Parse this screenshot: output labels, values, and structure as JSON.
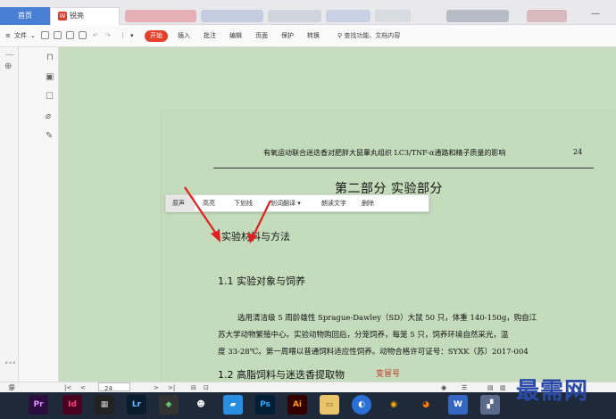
{
  "tabs": {
    "home": "首页",
    "doc": "锐亮"
  },
  "menu": {
    "file": "文件",
    "start": "开始",
    "insert": "插入",
    "comment": "批注",
    "edit": "编辑",
    "page": "页面",
    "protect": "保护",
    "convert": "转换",
    "search_placeholder": "查找功能、文档内容"
  },
  "document": {
    "header_text": "有氧运动联合迷迭香对肥胖大鼠睾丸组织 LC3/TNF-α通路和精子质量的影响",
    "header_page": "24",
    "part_title": "第二部分  实验部分",
    "section1": "实验材料与方法",
    "section1_1": "1.1 实验对象与饲养",
    "para_line1": "选用清洁级 5 周龄雄性 Sprague-Dawley（SD）大鼠 50 只，体重 140-150g，购自江",
    "para_line2": "苏大学动物繁殖中心。实验动物购回后，分笼饲养，每笼 5 只，饲养环境自然采光，温",
    "para_line3": "度 33-28℃。第一周喂以普通饲料适应性饲养。动物合格许可证号：SYXK（苏）2017-004",
    "section1_2": "1.2  高脂饲料与迷迭香提取物",
    "section1_2_mark": "变冒号"
  },
  "minibar": {
    "source": "原声",
    "highlight": "高亮",
    "underline": "下划线",
    "translate": "划词翻译",
    "read": "朗读文字",
    "delete": "删除"
  },
  "status": {
    "nav": "导航",
    "page_num": "24"
  },
  "taskbar": {
    "pr": "Pr",
    "id": "Id",
    "lr": "Lr",
    "ps": "Ps",
    "ai": "Ai"
  },
  "watermark": "最需网"
}
